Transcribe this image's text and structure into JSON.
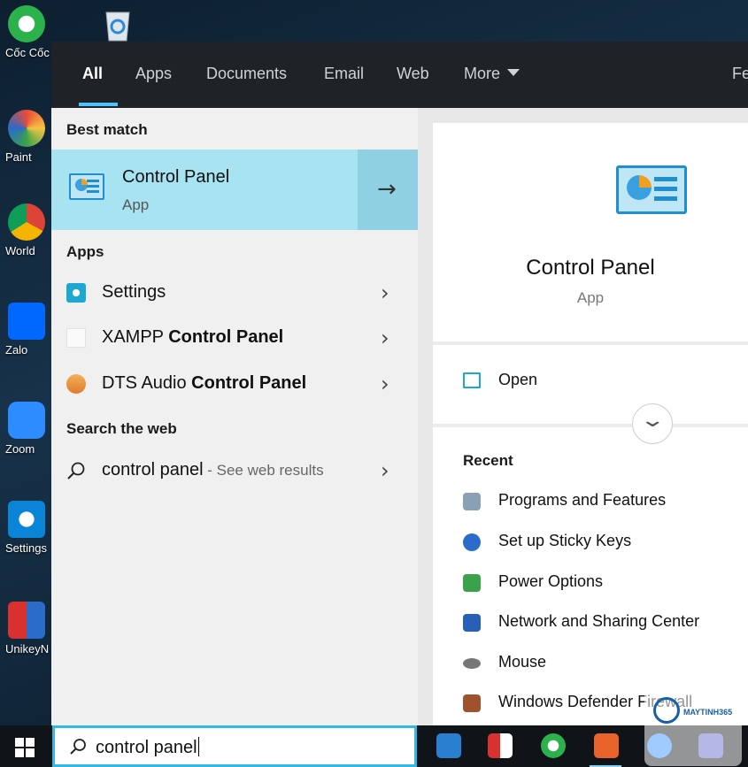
{
  "desktop": {
    "icons": [
      {
        "label": "Cốc Cốc",
        "color": "#2bb24c"
      },
      {
        "label": "Paint",
        "color": "#e8a23a"
      },
      {
        "label": "World",
        "color": "#db4437"
      },
      {
        "label": "Zalo",
        "color": "#0068ff"
      },
      {
        "label": "Zoom",
        "color": "#2d8cff"
      },
      {
        "label": "Settings",
        "color": "#0a84d6"
      },
      {
        "label": "UnikeyN",
        "color": "#d93030"
      }
    ]
  },
  "tabs": {
    "all": "All",
    "apps": "Apps",
    "documents": "Documents",
    "email": "Email",
    "web": "Web",
    "more": "More",
    "feedback_partial": "Fe"
  },
  "results": {
    "best_match_header": "Best match",
    "best_match": {
      "title": "Control Panel",
      "subtitle": "App",
      "arrow": "→"
    },
    "apps_header": "Apps",
    "apps": [
      {
        "icon": "settings-gear-icon",
        "prefix": "Settings",
        "bold": ""
      },
      {
        "icon": "xampp-icon",
        "prefix": "XAMPP ",
        "bold": "Control Panel"
      },
      {
        "icon": "dts-audio-icon",
        "prefix": "DTS Audio ",
        "bold": "Control Panel"
      }
    ],
    "web_header": "Search the web",
    "web": {
      "query": "control panel",
      "suffix": " - See web results"
    },
    "chevron": "›"
  },
  "preview": {
    "title": "Control Panel",
    "subtitle": "App",
    "open_label": "Open",
    "expand_glyph": "⌄",
    "recent_header": "Recent",
    "recent": [
      {
        "label": "Programs and Features",
        "icon_color": "#8aa0b4"
      },
      {
        "label": "Set up Sticky Keys",
        "icon_color": "#2a6cc8"
      },
      {
        "label": "Power Options",
        "icon_color": "#3aa24a"
      },
      {
        "label": "Network and Sharing Center",
        "icon_color": "#2a5fb8"
      },
      {
        "label": "Mouse",
        "icon_color": "#777777"
      },
      {
        "label": "Windows Defender Firewall",
        "icon_color": "#a0522d"
      }
    ]
  },
  "taskbar": {
    "search_value": "control panel"
  },
  "watermark": {
    "text": "MAYTINH365"
  },
  "colors": {
    "accent": "#4cc2ff",
    "best_match_bg": "#a8e3f2",
    "search_border": "#35b8e0"
  }
}
